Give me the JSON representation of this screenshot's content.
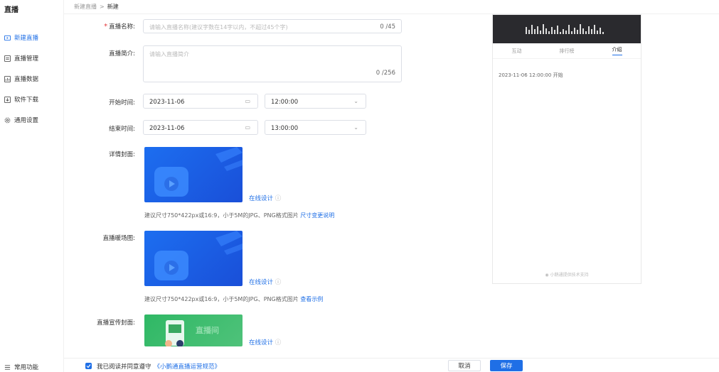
{
  "sidebar": {
    "title": "直播",
    "items": [
      {
        "label": "新建直播",
        "active": true
      },
      {
        "label": "直播管理"
      },
      {
        "label": "直播数据"
      },
      {
        "label": "软件下载"
      },
      {
        "label": "通用设置"
      }
    ],
    "bottom_label": "常用功能"
  },
  "breadcrumb": {
    "parent": "新建直播",
    "separator": ">",
    "current": "新建"
  },
  "form": {
    "name": {
      "label": "直播名称:",
      "placeholder": "请输入直播名称(建议字数在14字以内，不超过45个字)",
      "counter": "0 /45"
    },
    "intro": {
      "label": "直播简介:",
      "placeholder": "请输入直播简介",
      "counter": "0 /256"
    },
    "start": {
      "label": "开始时间:",
      "date": "2023-11-06",
      "time": "12:00:00"
    },
    "end": {
      "label": "结束时间:",
      "date": "2023-11-06",
      "time": "13:00:00"
    },
    "detail_cover": {
      "label": "详情封面:",
      "design_link": "在线设计",
      "hint": "建议尺寸750*422px或16:9，小于5M的JPG、PNG格式图片",
      "hint_link": "尺寸变更说明"
    },
    "warmup": {
      "label": "直播暖场图:",
      "design_link": "在线设计",
      "hint": "建议尺寸750*422px或16:9，小于5M的JPG、PNG格式图片",
      "hint_link": "查看示例"
    },
    "promo_cover": {
      "label": "直播宣传封面:",
      "design_link": "在线设计",
      "cover_text": "直播间"
    }
  },
  "preview": {
    "tabs": [
      "互动",
      "排行榜",
      "介绍"
    ],
    "start_text": "2023-11-06 12:00:00 开始",
    "footer": "小鹅通提供技术支持"
  },
  "footer": {
    "agree_text": "我已阅读并同意遵守",
    "agree_link": "《小鹅通直播运营规范》",
    "cancel": "取消",
    "save": "保存"
  },
  "colors": {
    "accent": "#1f6fe6",
    "required": "#e4393c"
  }
}
